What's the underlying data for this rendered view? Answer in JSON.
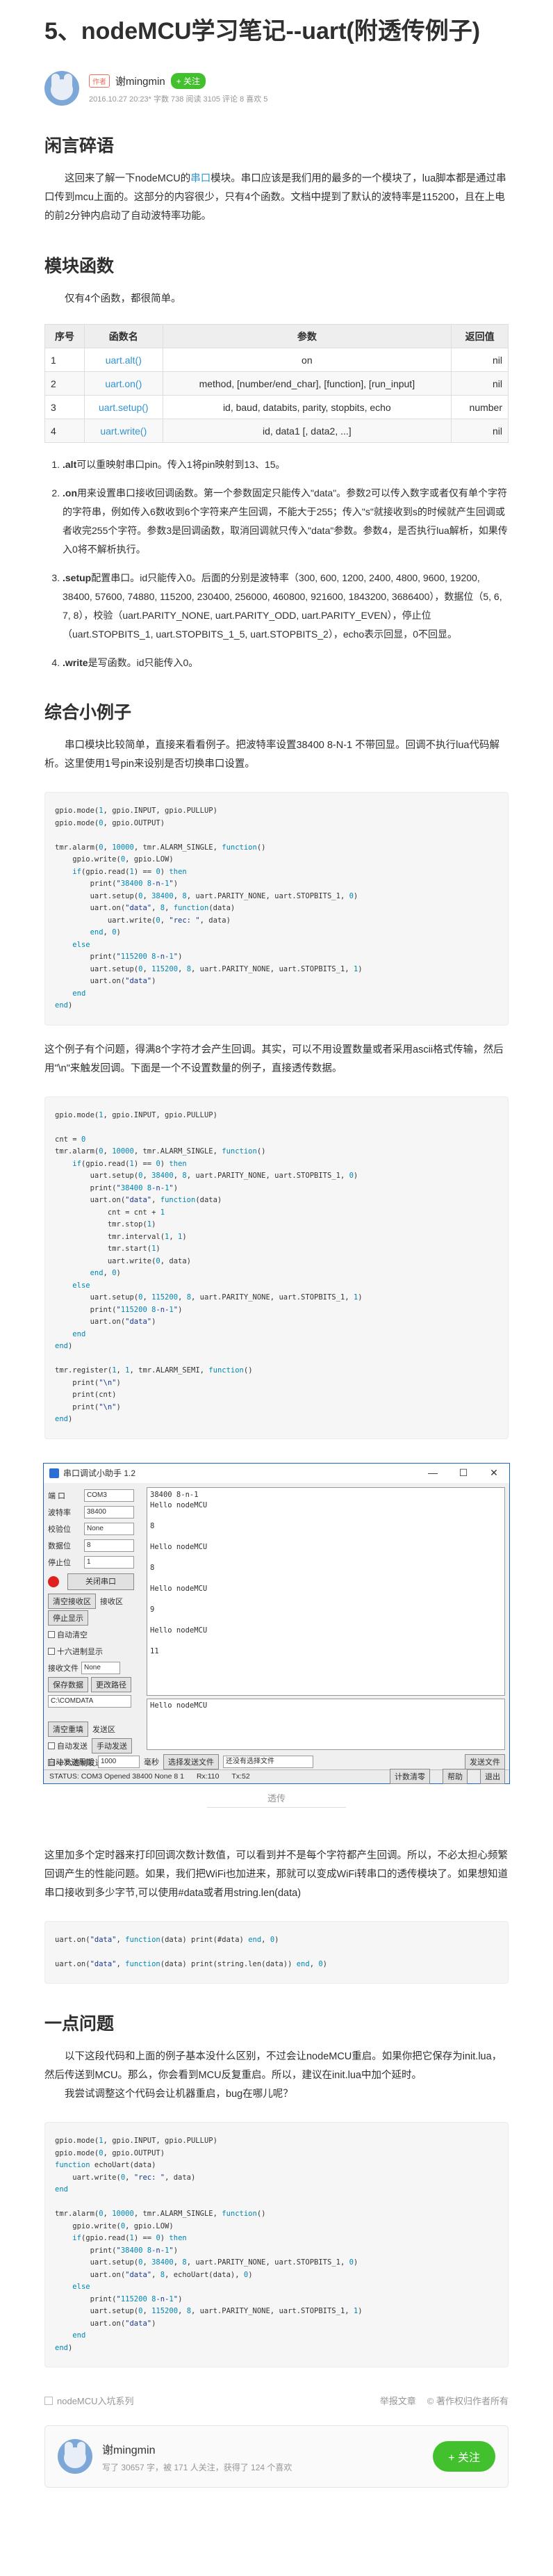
{
  "article": {
    "title": "5、nodeMCU学习笔记--uart(附透传例子)",
    "author": {
      "tag": "作者",
      "name": "谢mingmin",
      "follow": "+ 关注",
      "meta": "2016.10.27 20:23*  字数 738  阅读 3105 评论 8 喜欢 5"
    }
  },
  "sections": {
    "intro_heading": "闲言碎语",
    "intro_text_1": "这回来了解一下nodeMCU的",
    "intro_link": "串口",
    "intro_text_2": "模块。串口应该是我们用的最多的一个模块了，lua脚本都是通过串口传到mcu上面的。这部分的内容很少，只有4个函数。文档中提到了默认的波特率是115200，且在上电的前2分钟内启动了自动波特率功能。",
    "module_heading": "模块函数",
    "module_text": "仅有4个函数，都很简单。",
    "example_heading": "综合小例子",
    "example_text": "串口模块比较简单，直接来看看例子。把波特率设置38400 8-N-1 不带回显。回调不执行lua代码解析。这里使用1号pin来设别是否切换串口设置。",
    "example2_text": "这个例子有个问题，得满8个字符才会产生回调。其实，可以不用设置数量或者采用ascii格式传输，然后用\"\\n\"来触发回调。下面是一个不设置数量的例子，直接透传数据。",
    "caption": "透传",
    "after_caption": "这里加多个定时器来打印回调次数计数值，可以看到并不是每个字符都产生回调。所以，不必太担心频繁回调产生的性能问题。如果，我们把WiFi也加进来，那就可以变成WiFi转串口的透传模块了。如果想知道串口接收到多少字节,可以使用#data或者用string.len(data)",
    "problem_heading": "一点问题",
    "problem_text_1": "以下这段代码和上面的例子基本没什么区别，不过会让nodeMCU重启。如果你把它保存为init.lua，然后传送到MCU。那么，你会看到MCU反复重启。所以，建议在init.lua中加个延时。",
    "problem_text_2": "我尝试调整这个代码会让机器重启，bug在哪儿呢？"
  },
  "functions_table": {
    "headers": [
      "序号",
      "函数名",
      "参数",
      "返回值"
    ],
    "rows": [
      [
        "1",
        "uart.alt()",
        "on",
        "nil"
      ],
      [
        "2",
        "uart.on()",
        "method, [number/end_char], [function], [run_input]",
        "nil"
      ],
      [
        "3",
        "uart.setup()",
        "id, baud, databits, parity, stopbits, echo",
        "number"
      ],
      [
        "4",
        "uart.write()",
        "id, data1 [, data2, ...]",
        "nil"
      ]
    ]
  },
  "notes": [
    {
      "b": ".alt",
      "t": "可以重映射串口pin。传入1将pin映射到13、15。"
    },
    {
      "b": ".on",
      "t": "用来设置串口接收回调函数。第一个参数固定只能传入\"data\"。参数2可以传入数字或者仅有单个字符的字符串，例如传入6数收到6个字符来产生回调，不能大于255；传入\"s\"就接收到s的时候就产生回调或者收完255个字符。参数3是回调函数，取消回调就只传入\"data\"参数。参数4，是否执行lua解析，如果传入0将不解析执行。"
    },
    {
      "b": ".setup",
      "t": "配置串口。id只能传入0。后面的分别是波特率（300, 600, 1200, 2400, 4800, 9600, 19200, 38400, 57600, 74880, 115200, 230400, 256000, 460800, 921600, 1843200, 3686400），数据位（5, 6, 7, 8），校验（uart.PARITY_NONE, uart.PARITY_ODD, uart.PARITY_EVEN），停止位（uart.STOPBITS_1, uart.STOPBITS_1_5, uart.STOPBITS_2），echo表示回显，0不回显。"
    },
    {
      "b": ".write",
      "t": "是写函数。id只能传入0。"
    }
  ],
  "code1": "gpio.mode(1, gpio.INPUT, gpio.PULLUP)\ngpio.mode(0, gpio.OUTPUT)\n\ntmr.alarm(0, 10000, tmr.ALARM_SINGLE, function()\n    gpio.write(0, gpio.LOW)\n    if(gpio.read(1) == 0) then\n        print(\"38400 8-n-1\")\n        uart.setup(0, 38400, 8, uart.PARITY_NONE, uart.STOPBITS_1, 0)\n        uart.on(\"data\", 8, function(data)\n            uart.write(0, \"rec: \", data)\n        end, 0)\n    else\n        print(\"115200 8-n-1\")\n        uart.setup(0, 115200, 8, uart.PARITY_NONE, uart.STOPBITS_1, 1)\n        uart.on(\"data\")\n    end\nend)",
  "code2": "gpio.mode(1, gpio.INPUT, gpio.PULLUP)\n\ncnt = 0\ntmr.alarm(0, 10000, tmr.ALARM_SINGLE, function()\n    if(gpio.read(1) == 0) then\n        uart.setup(0, 38400, 8, uart.PARITY_NONE, uart.STOPBITS_1, 0)\n        print(\"38400 8-n-1\")\n        uart.on(\"data\", function(data)\n            cnt = cnt + 1\n            tmr.stop(1)\n            tmr.interval(1, 1)\n            tmr.start(1)\n            uart.write(0, data)\n        end, 0)\n    else\n        uart.setup(0, 115200, 8, uart.PARITY_NONE, uart.STOPBITS_1, 1)\n        print(\"115200 8-n-1\")\n        uart.on(\"data\")\n    end\nend)\n\ntmr.register(1, 1, tmr.ALARM_SEMI, function()\n    print(\"\\n\")\n    print(cnt)\n    print(\"\\n\")\nend)",
  "code3": "uart.on(\"data\", function(data) print(#data) end, 0)\n\nuart.on(\"data\", function(data) print(string.len(data)) end, 0)",
  "code4": "gpio.mode(1, gpio.INPUT, gpio.PULLUP)\ngpio.mode(0, gpio.OUTPUT)\nfunction echoUart(data)\n    uart.write(0, \"rec: \", data)\nend\n\ntmr.alarm(0, 10000, tmr.ALARM_SINGLE, function()\n    gpio.write(0, gpio.LOW)\n    if(gpio.read(1) == 0) then\n        print(\"38400 8-n-1\")\n        uart.setup(0, 38400, 8, uart.PARITY_NONE, uart.STOPBITS_1, 0)\n        uart.on(\"data\", 8, echoUart(data), 0)\n    else\n        print(\"115200 8-n-1\")\n        uart.setup(0, 115200, 8, uart.PARITY_NONE, uart.STOPBITS_1, 1)\n        uart.on(\"data\")\n    end\nend)",
  "serial_tool": {
    "title": "串口调试小助手 1.2",
    "labels": {
      "port": "端 口",
      "baud": "波特率",
      "parity": "校验位",
      "databits": "数据位",
      "stopbits": "停止位"
    },
    "values": {
      "port": "COM3",
      "baud": "38400",
      "parity": "None",
      "databits": "8",
      "stopbits": "1"
    },
    "open_button": "关闭串口",
    "clear_recv": "清空接收区",
    "recv_area": "接收区",
    "stop_show": "停止显示",
    "auto_clear": "自动清空",
    "hex_show": "十六进制显示",
    "recv_file": "接收文件",
    "recv_file_value": "None",
    "save_data": "保存数据",
    "change_path": "更改路径",
    "path": "C:\\COMDATA",
    "clear_send": "清空重填",
    "send_area": "发送区",
    "auto_send": "自动发送",
    "manual_send": "手动发送",
    "hex_send": "十六进制发送",
    "send_period_label": "自动发送周期",
    "send_period": "1000",
    "ms": "毫秒",
    "choose_file": "选择发送文件",
    "no_file": "还没有选择文件",
    "send_file": "发送文件",
    "reset_count": "计数清零",
    "help": "帮助",
    "exit": "退出",
    "received_text": "38400 8-n-1\nHello nodeMCU\n\n8\n\nHello nodeMCU\n\n8\n\nHello nodeMCU\n\n9\n\nHello nodeMCU\n\n11",
    "send_text": "Hello nodeMCU",
    "status": "STATUS: COM3 Opened 38400 None 8 1",
    "rx": "Rx:110",
    "tx": "Tx:52"
  },
  "footer": {
    "collection": "nodeMCU入坑系列",
    "report": "举报文章",
    "copyright": "© 著作权归作者所有",
    "card_name": "谢mingmin",
    "card_sub": "写了 30657 字，被 171 人关注，获得了 124 个喜欢",
    "card_follow": "+ 关注"
  }
}
